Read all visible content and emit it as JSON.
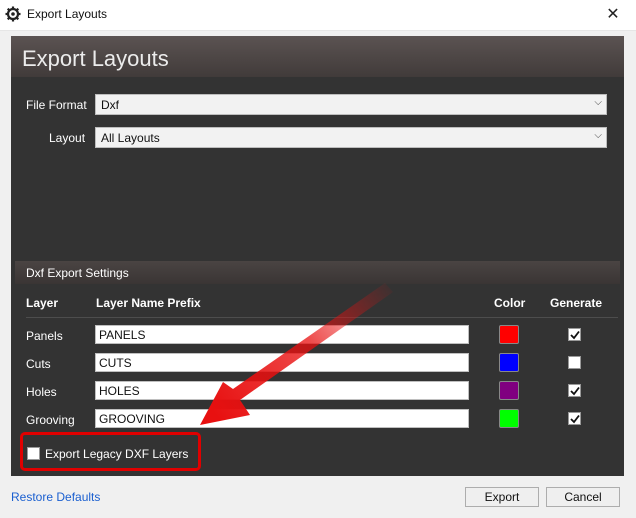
{
  "window": {
    "title": "Export Layouts",
    "close_glyph": "✕"
  },
  "header": {
    "title": "Export Layouts"
  },
  "form": {
    "file_format_label": "File Format",
    "file_format_value": "Dxf",
    "layout_label": "Layout",
    "layout_value": "All Layouts"
  },
  "settings": {
    "title": "Dxf Export Settings",
    "columns": {
      "layer": "Layer",
      "prefix": "Layer Name Prefix",
      "color": "Color",
      "generate": "Generate"
    },
    "rows": [
      {
        "layer": "Panels",
        "prefix": "PANELS",
        "color": "#ff0000",
        "generate": true
      },
      {
        "layer": "Cuts",
        "prefix": "CUTS",
        "color": "#0000ff",
        "generate": false
      },
      {
        "layer": "Holes",
        "prefix": "HOLES",
        "color": "#800080",
        "generate": true
      },
      {
        "layer": "Grooving",
        "prefix": "GROOVING",
        "color": "#00ff00",
        "generate": true
      }
    ]
  },
  "legacy": {
    "label": "Export Legacy DXF Layers",
    "checked": false
  },
  "footer": {
    "restore_label": "Restore Defaults",
    "export_label": "Export",
    "cancel_label": "Cancel"
  },
  "annotation": {
    "highlight_color": "#e00000",
    "arrow_color": "#e81010"
  }
}
